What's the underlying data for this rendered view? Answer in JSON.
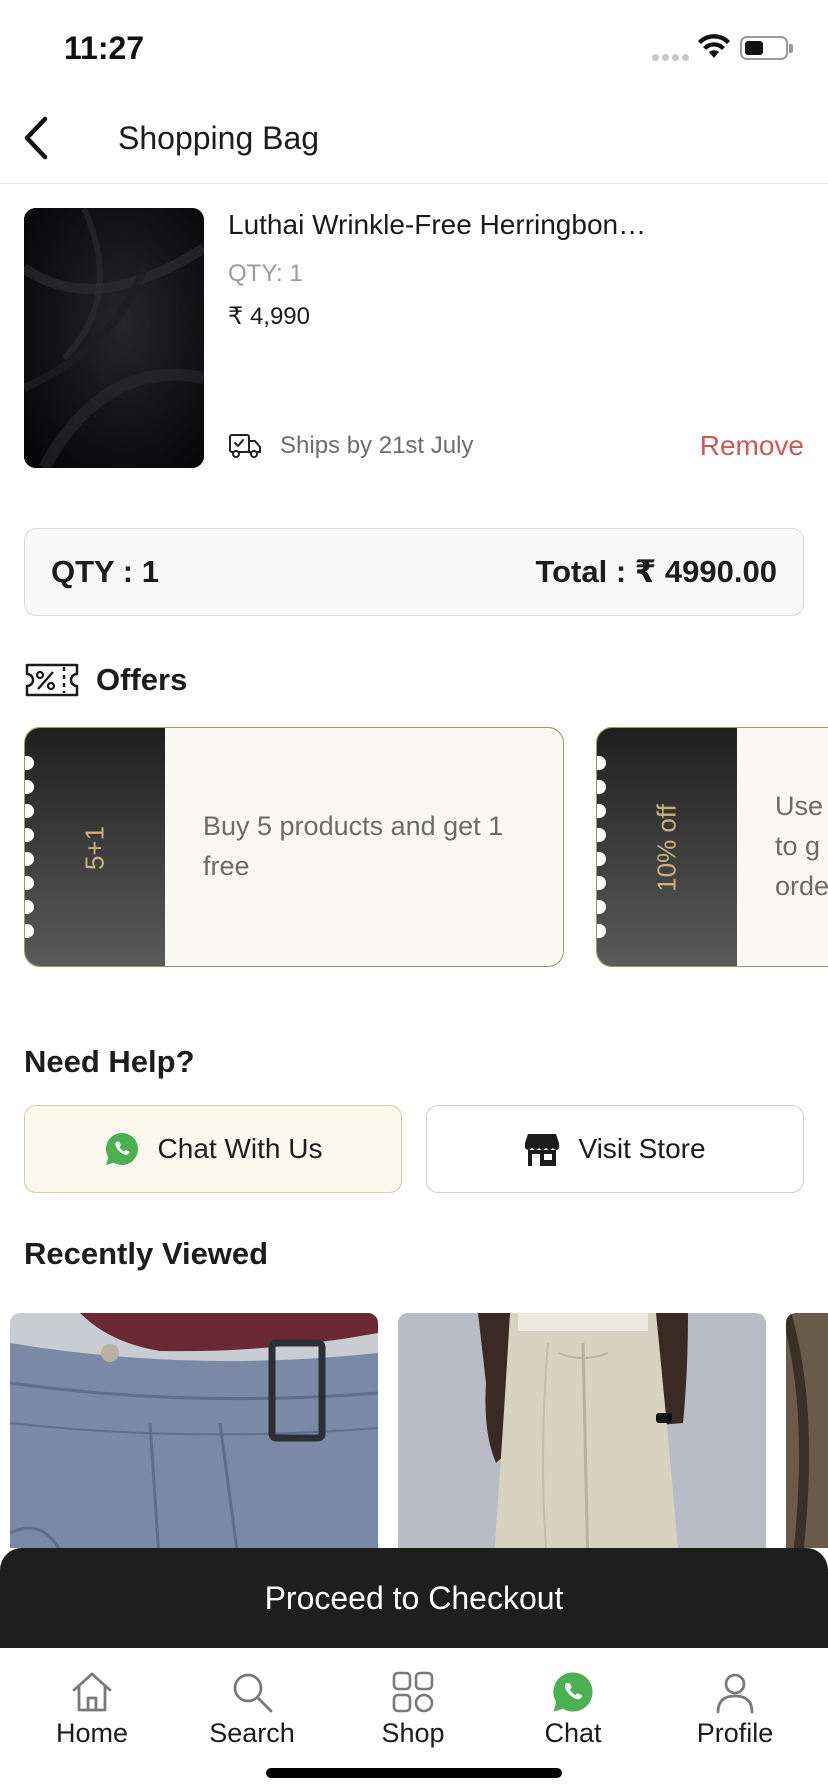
{
  "status_bar": {
    "time": "11:27"
  },
  "header": {
    "title": "Shopping Bag"
  },
  "cart_item": {
    "name": "Luthai Wrinkle-Free Herringbon…",
    "qty": "QTY: 1",
    "price": "₹ 4,990",
    "shipping": "Ships by 21st July",
    "remove_label": "Remove"
  },
  "summary": {
    "qty": "QTY : 1",
    "total": "Total : ₹ 4990.00"
  },
  "offers": {
    "title": "Offers",
    "items": [
      {
        "code": "5+1",
        "description": "Buy 5 products and get 1 free"
      },
      {
        "code": "10% off",
        "description": "Use\nto g\norde"
      }
    ]
  },
  "help": {
    "title": "Need Help?",
    "chat_label": "Chat With Us",
    "store_label": "Visit Store"
  },
  "recent": {
    "title": "Recently Viewed"
  },
  "checkout": {
    "label": "Proceed to Checkout"
  },
  "tabbar": {
    "items": [
      {
        "label": "Home",
        "icon": "home-icon"
      },
      {
        "label": "Search",
        "icon": "search-icon"
      },
      {
        "label": "Shop",
        "icon": "grid-icon"
      },
      {
        "label": "Chat",
        "icon": "whatsapp-icon"
      },
      {
        "label": "Profile",
        "icon": "profile-icon"
      }
    ]
  },
  "colors": {
    "accent_remove": "#c95a55",
    "offer_border": "#a09462",
    "offer_code": "#c8b07a",
    "whatsapp": "#4caf50",
    "checkout_bg": "#1f1e1f"
  }
}
